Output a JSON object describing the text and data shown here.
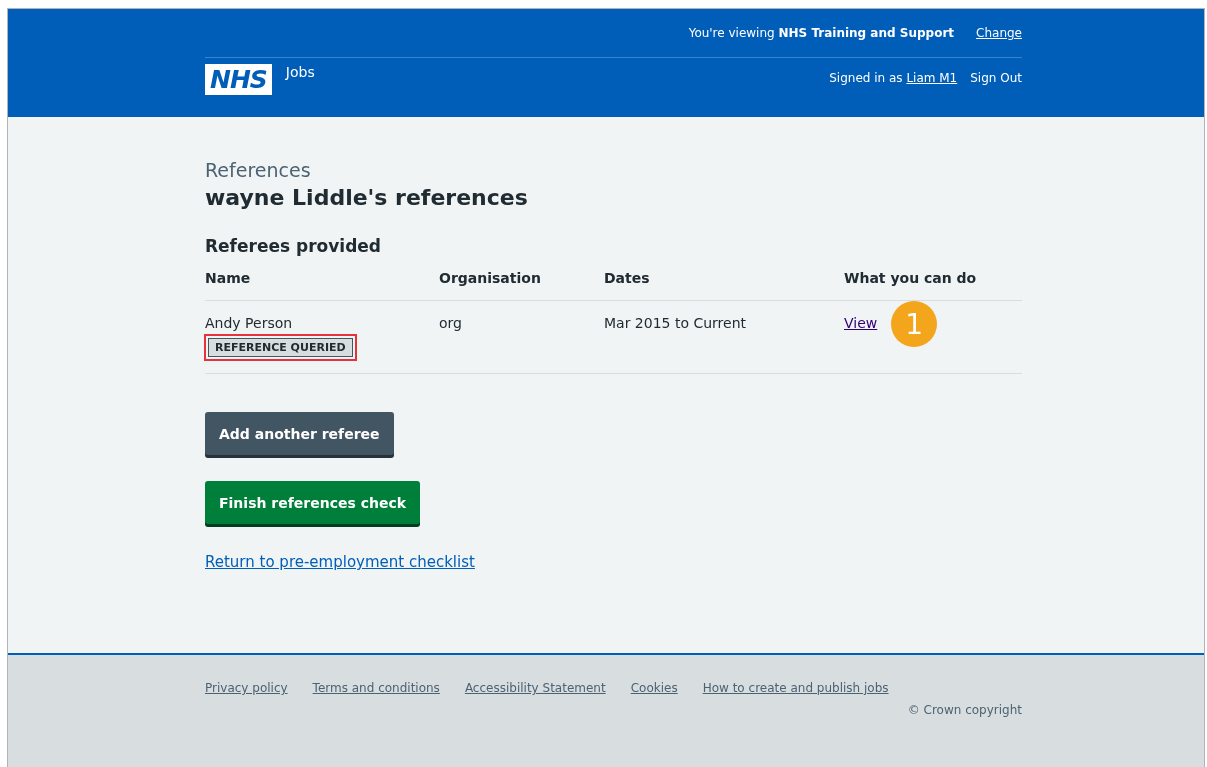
{
  "header": {
    "logo": "NHS",
    "service": "Jobs",
    "viewing_prefix": "You're viewing ",
    "viewing_org": "NHS Training and Support",
    "change_link": "Change",
    "signed_in_prefix": "Signed in as ",
    "user_link": "Liam M1",
    "sign_out": "Sign Out"
  },
  "caption": "References",
  "title": "wayne Liddle's references",
  "section_title": "Referees provided",
  "table": {
    "columns": [
      "Name",
      "Organisation",
      "Dates",
      "What you can do"
    ],
    "rows": [
      {
        "name": "Andy Person",
        "tag": "REFERENCE QUERIED",
        "tag_highlighted": true,
        "organisation": "org",
        "dates": "Mar 2015 to Current",
        "action": "View",
        "callout": "1"
      }
    ]
  },
  "buttons": [
    {
      "label": "Add another referee",
      "kind": "secondary"
    },
    {
      "label": "Finish references check",
      "kind": "primary"
    }
  ],
  "return_link": "Return to pre-employment checklist",
  "footer": {
    "links": [
      "Privacy policy",
      "Terms and conditions",
      "Accessibility Statement",
      "Cookies",
      "How to create and publish jobs"
    ],
    "copyright": "© Crown copyright"
  }
}
